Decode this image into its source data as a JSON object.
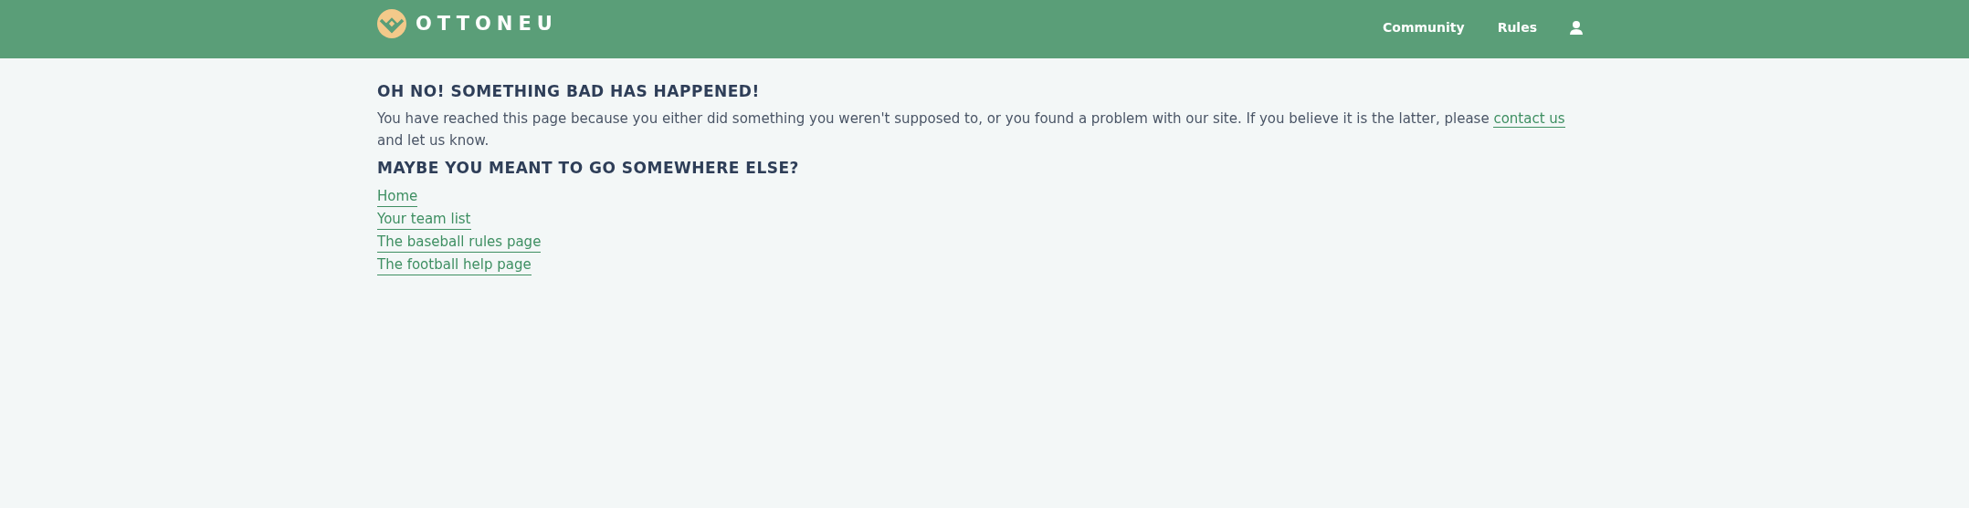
{
  "header": {
    "logo_text": "OTTONEU",
    "nav": [
      "Community",
      "Rules"
    ]
  },
  "error": {
    "title": "OH NO! SOMETHING BAD HAS HAPPENED!",
    "message_before": "You have reached this page because you either did something you weren't supposed to, or you found a problem with our site. If you believe it is the latter, please ",
    "message_link": "contact us",
    "message_after": " and let us know."
  },
  "suggestions": {
    "title": "MAYBE YOU MEANT TO GO SOMEWHERE ELSE?",
    "links": [
      "Home",
      "Your team list",
      "The baseball rules page",
      "The football help page"
    ]
  }
}
